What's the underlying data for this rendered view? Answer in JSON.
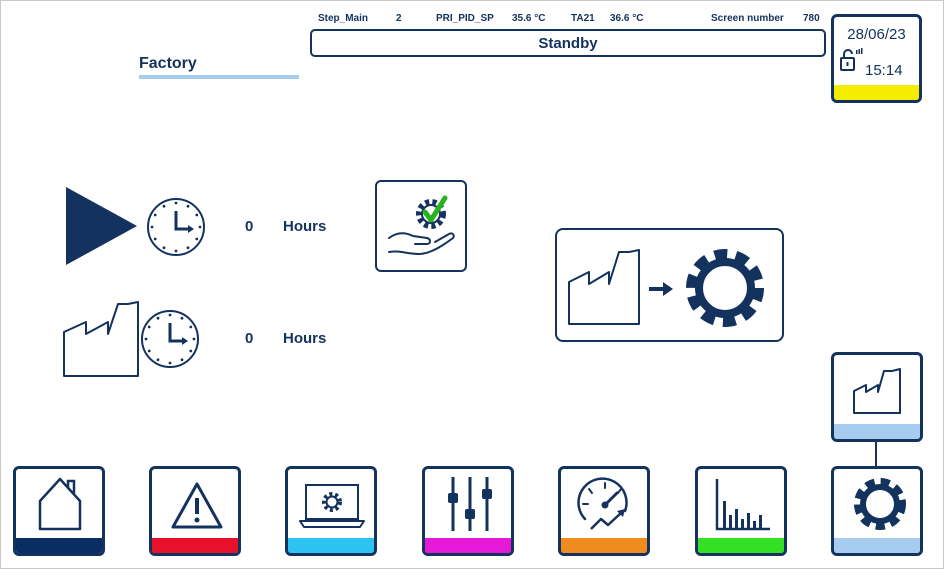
{
  "header": {
    "step_main_label": "Step_Main",
    "step_main_value": "2",
    "pri_pid_label": "PRI_PID_SP",
    "pri_pid_value": "35.6 °C",
    "ta21_label": "TA21",
    "ta21_value": "36.6 °C",
    "screen_number_label": "Screen number",
    "screen_number_value": "780",
    "state": "Standby"
  },
  "page": {
    "title": "Factory"
  },
  "clock": {
    "date": "28/06/23",
    "time": "15:14",
    "status_color": "#f5ec00"
  },
  "counters": [
    {
      "icon": "run-play-icon",
      "value": "0",
      "unit": "Hours"
    },
    {
      "icon": "factory-icon",
      "value": "0",
      "unit": "Hours"
    }
  ],
  "nav": [
    {
      "name": "home",
      "icon": "home-icon",
      "color": "#0a2d63"
    },
    {
      "name": "alarms",
      "icon": "warning-icon",
      "color": "#e8102a"
    },
    {
      "name": "monitor",
      "icon": "monitor-gear-icon",
      "color": "#2cc3f3"
    },
    {
      "name": "settings",
      "icon": "sliders-icon",
      "color": "#e619d8"
    },
    {
      "name": "performance",
      "icon": "gauge-icon",
      "color": "#f08c1e"
    },
    {
      "name": "charts",
      "icon": "bar-chart-icon",
      "color": "#33e024"
    },
    {
      "name": "factory-settings",
      "icon": "gear-icon",
      "color": "#a6ccef"
    }
  ],
  "side": {
    "factory_tile_color": "#a6ccef"
  }
}
